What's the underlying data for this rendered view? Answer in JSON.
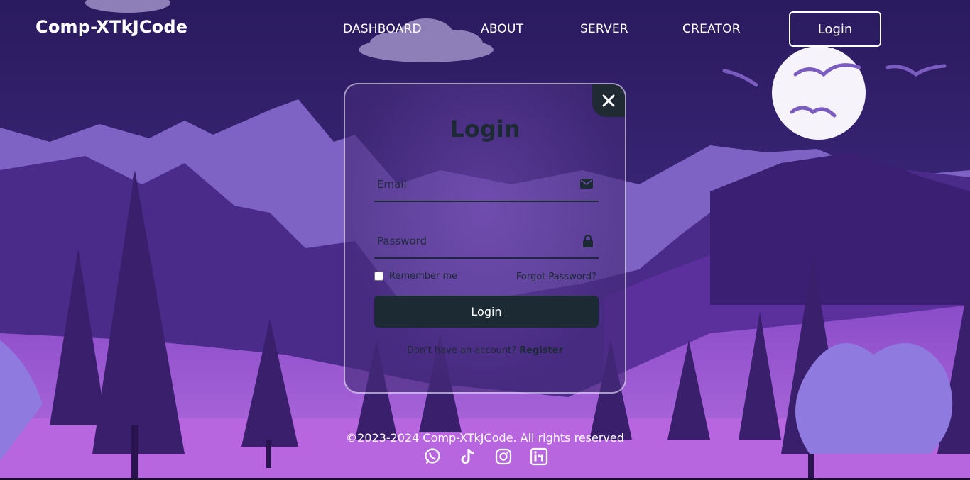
{
  "header": {
    "logo": "Comp-XTkJCode",
    "nav": [
      {
        "label": "DASHBOARD"
      },
      {
        "label": "ABOUT"
      },
      {
        "label": "SERVER"
      },
      {
        "label": "CREATOR"
      }
    ],
    "login_button": "Login"
  },
  "modal": {
    "title": "Login",
    "email_placeholder": "Email",
    "password_placeholder": "Password",
    "remember_label": "Remember me",
    "forgot_label": "Forgot Password?",
    "submit_label": "Login",
    "register_prompt": "Don't have an account?",
    "register_link": "Register"
  },
  "footer": {
    "copyright": "©2023-2024 Comp-XTkJCode. All rights reserved",
    "social_icons": [
      "whatsapp-icon",
      "tiktok-icon",
      "instagram-icon",
      "linkedin-icon"
    ]
  },
  "colors": {
    "accent_dark": "#1c2a33",
    "sky": "#3a2470",
    "mountain_light": "#8a68cc",
    "ground": "#a45cd6"
  }
}
